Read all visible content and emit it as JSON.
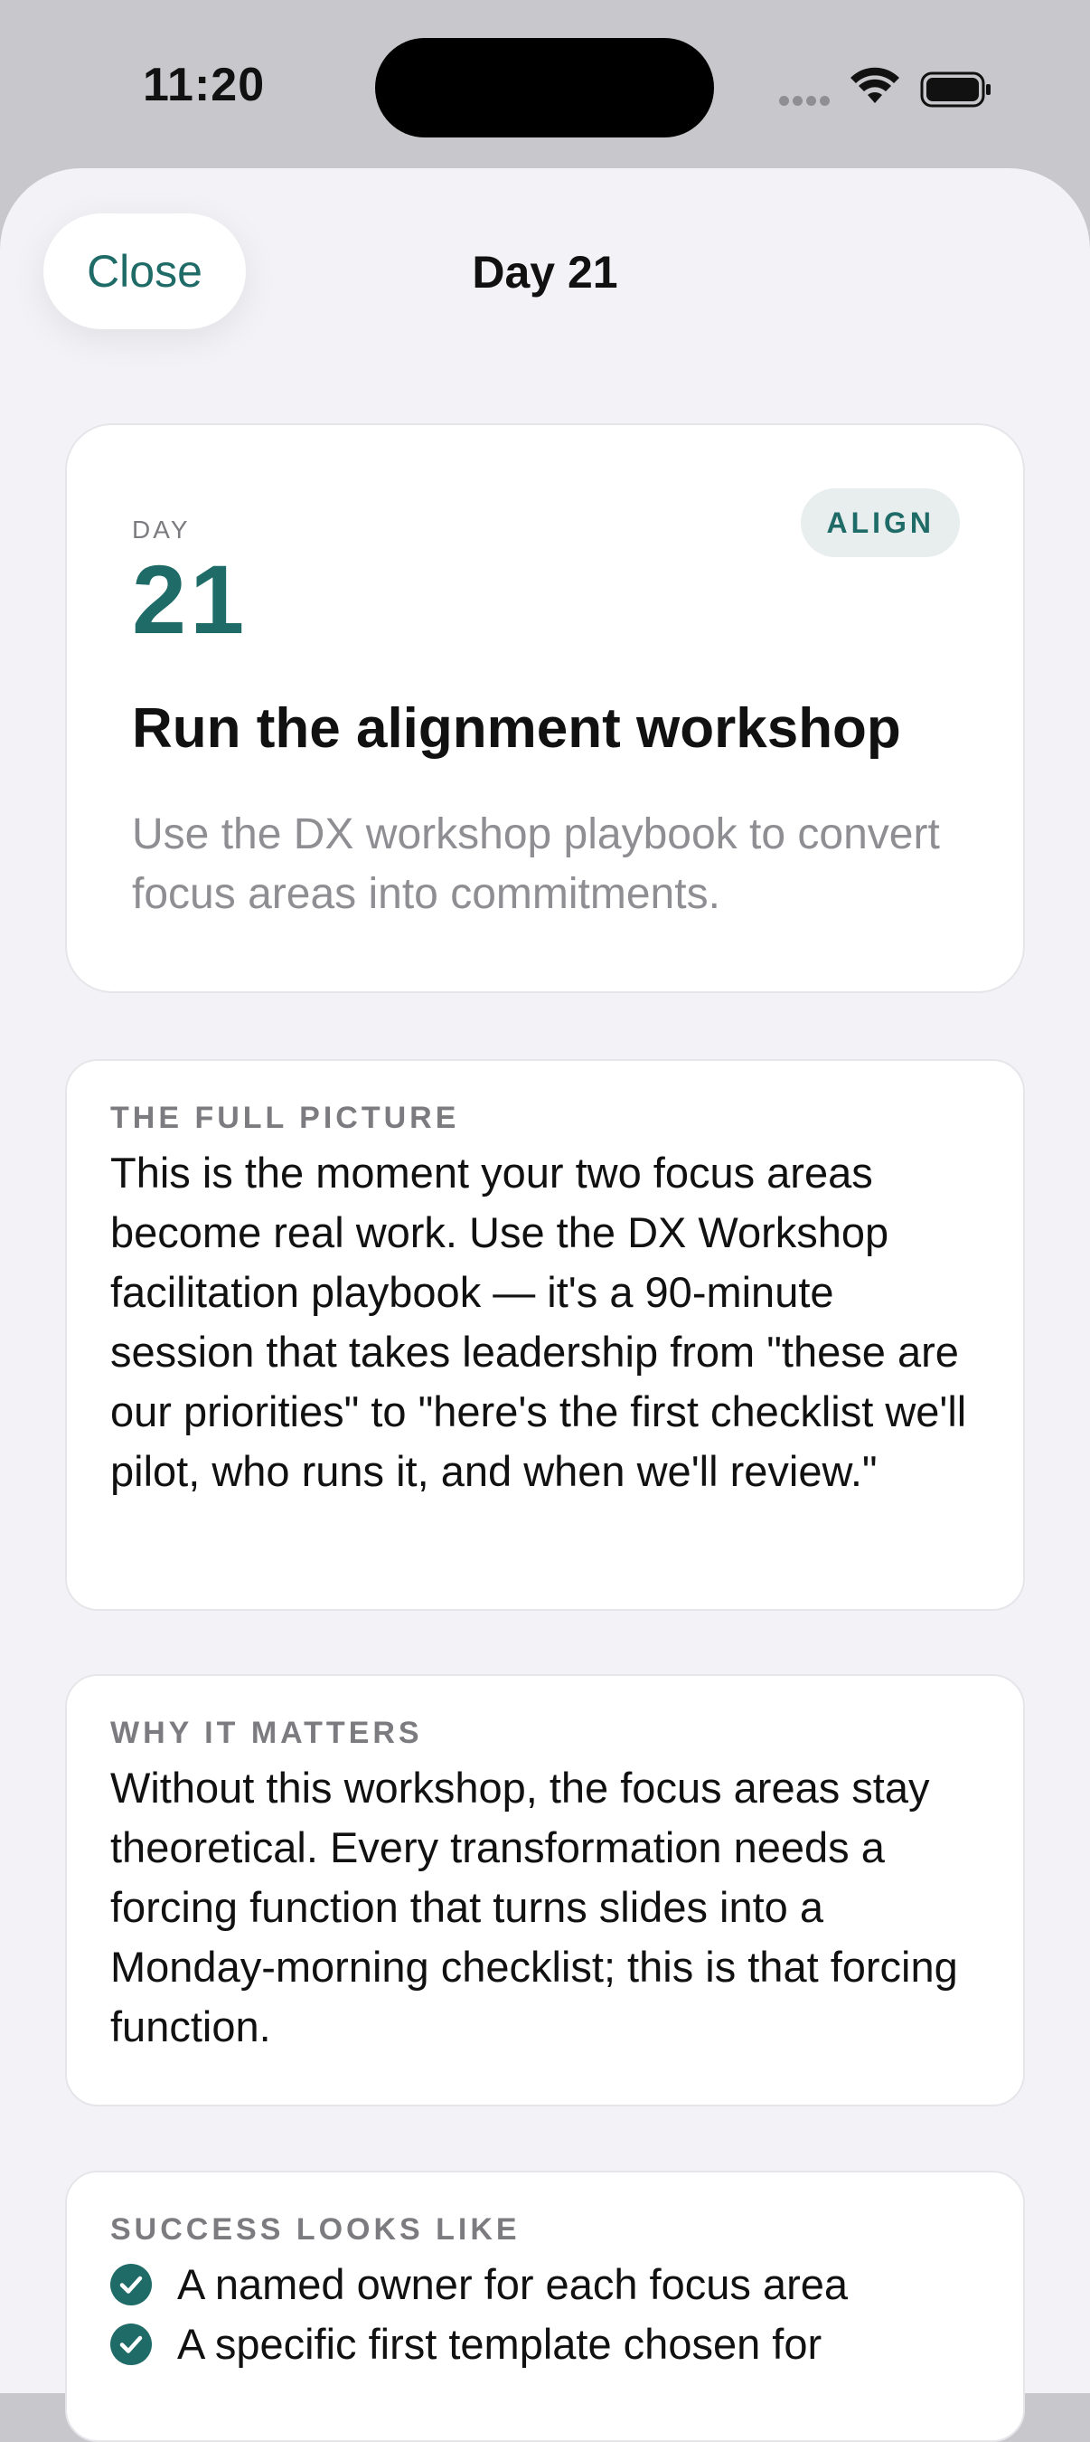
{
  "status_bar": {
    "time": "11:20"
  },
  "nav": {
    "close_label": "Close",
    "title": "Day 21"
  },
  "hero": {
    "day_label": "DAY",
    "day_number": "21",
    "badge": "ALIGN",
    "title": "Run the alignment workshop",
    "description": "Use the DX workshop playbook to convert focus areas into commitments."
  },
  "full_picture": {
    "label": "THE FULL PICTURE",
    "text": "This is the moment your two focus areas become real work. Use the DX Workshop facilitation playbook — it's a 90-minute session that takes leadership from \"these are our priorities\" to \"here's the first checklist we'll pilot, who runs it, and when we'll review.\""
  },
  "why_it_matters": {
    "label": "WHY IT MATTERS",
    "text": "Without this workshop, the focus areas stay theoretical. Every transformation needs a forcing function that turns slides into a Monday-morning checklist; this is that forcing function."
  },
  "success": {
    "label": "SUCCESS LOOKS LIKE",
    "items": [
      "A named owner for each focus area",
      "A specific first template chosen for"
    ]
  },
  "colors": {
    "accent": "#1f6b67",
    "background": "#f2f2f7",
    "badge_bg": "#e7eeed"
  }
}
